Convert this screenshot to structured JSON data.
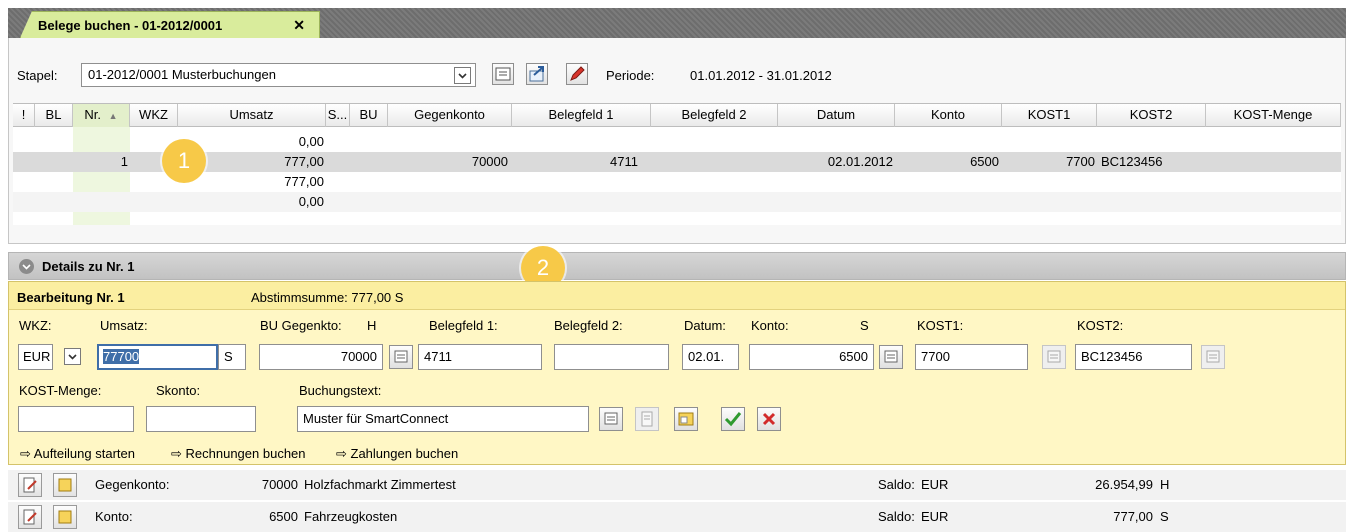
{
  "tab": {
    "title": "Belege buchen - 01-2012/0001",
    "close": "✕"
  },
  "toolbar": {
    "stapel_label": "Stapel:",
    "stapel_value": "01-2012/0001  Musterbuchungen",
    "periode_label": "Periode:",
    "periode_value": "01.01.2012 - 31.01.2012"
  },
  "grid": {
    "headers": [
      "!",
      "BL",
      "Nr.",
      "WKZ",
      "Umsatz",
      "S...",
      "BU",
      "Gegenkonto",
      "Belegfeld 1",
      "Belegfeld 2",
      "Datum",
      "Konto",
      "KOST1",
      "KOST2",
      "KOST-Menge"
    ],
    "sort_indicator": "▲",
    "rows": [
      {
        "nr": "",
        "umsatz": "0,00",
        "gegenkonto": "",
        "belegfeld1": "",
        "datum": "",
        "konto": "",
        "kost1": "",
        "kost2": ""
      },
      {
        "nr": "1",
        "umsatz": "777,00",
        "gegenkonto": "70000",
        "belegfeld1": "4711",
        "datum": "02.01.2012",
        "konto": "6500",
        "kost1": "7700",
        "kost2": "BC123456"
      },
      {
        "nr": "",
        "umsatz": "777,00",
        "gegenkonto": "",
        "belegfeld1": "",
        "datum": "",
        "konto": "",
        "kost1": "",
        "kost2": ""
      },
      {
        "nr": "",
        "umsatz": "0,00",
        "gegenkonto": "",
        "belegfeld1": "",
        "datum": "",
        "konto": "",
        "kost1": "",
        "kost2": ""
      }
    ]
  },
  "badges": {
    "one": "1",
    "two": "2"
  },
  "details": {
    "title": "Details zu Nr. 1",
    "bearbeitung": "Bearbeitung Nr. 1",
    "abstimmsumme": "Abstimmsumme: 777,00 S",
    "labels": {
      "wkz": "WKZ:",
      "umsatz": "Umsatz:",
      "bu_gegenkto": "BU Gegenkto:",
      "bu_side": "H",
      "belegfeld1": "Belegfeld 1:",
      "belegfeld2": "Belegfeld 2:",
      "datum": "Datum:",
      "konto": "Konto:",
      "konto_side": "S",
      "kost1": "KOST1:",
      "kost2": "KOST2:",
      "kost_menge": "KOST-Menge:",
      "skonto": "Skonto:",
      "buchungstext": "Buchungstext:"
    },
    "values": {
      "wkz": "EUR",
      "umsatz": "77700",
      "umsatz_side": "S",
      "bu": "",
      "gegenkonto": "70000",
      "belegfeld1": "4711",
      "belegfeld2": "",
      "datum": "02.01.",
      "konto": "6500",
      "kost1": "7700",
      "kost2": "BC123456",
      "kost_menge": "",
      "skonto": "",
      "buchungstext": "Muster für SmartConnect"
    },
    "links": {
      "aufteilung": "Aufteilung starten",
      "rechnungen": "Rechnungen buchen",
      "zahlungen": "Zahlungen buchen"
    }
  },
  "footer": [
    {
      "label": "Gegenkonto:",
      "number": "70000",
      "name": "Holzfachmarkt Zimmertest",
      "saldo_label": "Saldo:",
      "currency": "EUR",
      "amount": "26.954,99",
      "side": "H"
    },
    {
      "label": "Konto:",
      "number": "6500",
      "name": "Fahrzeugkosten",
      "saldo_label": "Saldo:",
      "currency": "EUR",
      "amount": "777,00",
      "side": "S"
    }
  ],
  "colors": {
    "tab_active": "#d9ec9c",
    "highlight_row": "#dadada",
    "edit_bg": "#fff7c5",
    "badge": "#f7c948",
    "nr_column": "#eef7df"
  }
}
